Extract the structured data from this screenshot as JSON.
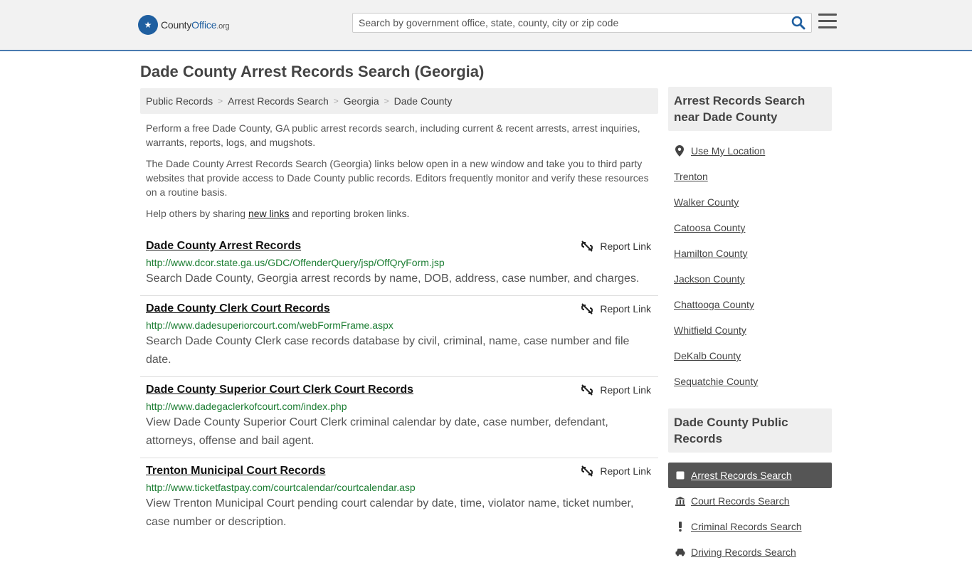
{
  "header": {
    "logo_main": "County",
    "logo_brand": "Office",
    "logo_tld": ".org",
    "search_placeholder": "Search by government office, state, county, city or zip code"
  },
  "page_title": "Dade County Arrest Records Search (Georgia)",
  "breadcrumb": [
    "Public Records",
    "Arrest Records Search",
    "Georgia",
    "Dade County"
  ],
  "intro": {
    "p1": "Perform a free Dade County, GA public arrest records search, including current & recent arrests, arrest inquiries, warrants, reports, logs, and mugshots.",
    "p2": "The Dade County Arrest Records Search (Georgia) links below open in a new window and take you to third party websites that provide access to Dade County public records. Editors frequently monitor and verify these resources on a routine basis.",
    "p3_before": "Help others by sharing ",
    "p3_link": "new links",
    "p3_after": " and reporting broken links."
  },
  "report_label": "Report Link",
  "results": [
    {
      "title": "Dade County Arrest Records",
      "url": "http://www.dcor.state.ga.us/GDC/OffenderQuery/jsp/OffQryForm.jsp",
      "desc": "Search Dade County, Georgia arrest records by name, DOB, address, case number, and charges."
    },
    {
      "title": "Dade County Clerk Court Records",
      "url": "http://www.dadesuperiorcourt.com/webFormFrame.aspx",
      "desc": "Search Dade County Clerk case records database by civil, criminal, name, case number and file date."
    },
    {
      "title": "Dade County Superior Court Clerk Court Records",
      "url": "http://www.dadegaclerkofcourt.com/index.php",
      "desc": "View Dade County Superior Court Clerk criminal calendar by date, case number, defendant, attorneys, offense and bail agent."
    },
    {
      "title": "Trenton Municipal Court Records",
      "url": "http://www.ticketfastpay.com/courtcalendar/courtcalendar.asp",
      "desc": "View Trenton Municipal Court pending court calendar by date, time, violator name, ticket number, case number or description."
    }
  ],
  "sidebar": {
    "nearby_heading": "Arrest Records Search near Dade County",
    "use_location": "Use My Location",
    "nearby": [
      "Trenton",
      "Walker County",
      "Catoosa County",
      "Hamilton County",
      "Jackson County",
      "Chattooga County",
      "Whitfield County",
      "DeKalb County",
      "Sequatchie County"
    ],
    "records_heading": "Dade County Public Records",
    "records": [
      {
        "label": "Arrest Records Search",
        "icon": "square-icon",
        "active": true
      },
      {
        "label": "Court Records Search",
        "icon": "courthouse-icon",
        "active": false
      },
      {
        "label": "Criminal Records Search",
        "icon": "exclamation-icon",
        "active": false
      },
      {
        "label": "Driving Records Search",
        "icon": "car-icon",
        "active": false
      }
    ]
  },
  "colors": {
    "accent_blue": "#1f5fa0",
    "url_green": "#1b7d32",
    "active_nav": "#555555"
  }
}
